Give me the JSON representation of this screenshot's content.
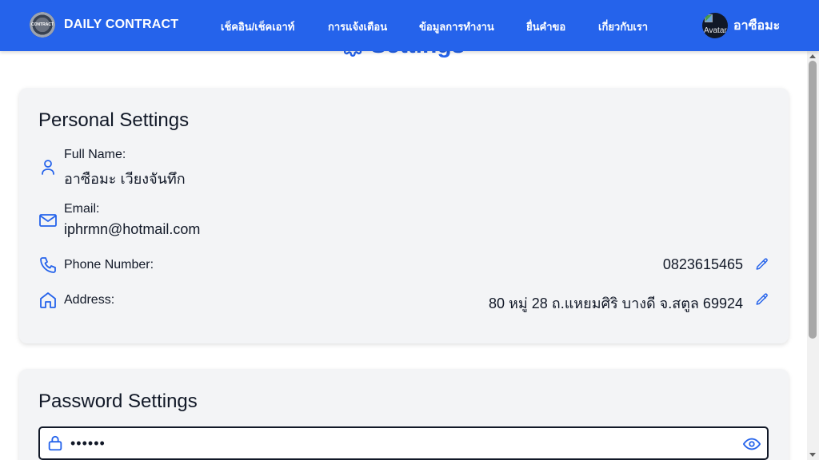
{
  "navbar": {
    "brand": "DAILY CONTRACT",
    "logo_text": "CONTRACT",
    "links": [
      "เช็คอิน/เช็คเอาท์",
      "การแจ้งเตือน",
      "ข้อมูลการทำงาน",
      "ยื่นคำขอ",
      "เกี่ยวกับเรา"
    ],
    "avatar_alt": "Avatar",
    "user_name": "อาซือมะ",
    "color": "#2563eb"
  },
  "page": {
    "title": "Settings"
  },
  "personal": {
    "title": "Personal Settings",
    "full_name_label": "Full Name:",
    "full_name": "อาซือมะ เวียงจันทึก",
    "email_label": "Email:",
    "email": "iphrmn@hotmail.com",
    "phone_label": "Phone Number:",
    "phone": "0823615465",
    "address_label": "Address:",
    "address": "80 หมู่ 28 ถ.แหยมศิริ บางดี จ.สตูล 69924"
  },
  "password": {
    "title": "Password Settings",
    "value": "••••••"
  }
}
